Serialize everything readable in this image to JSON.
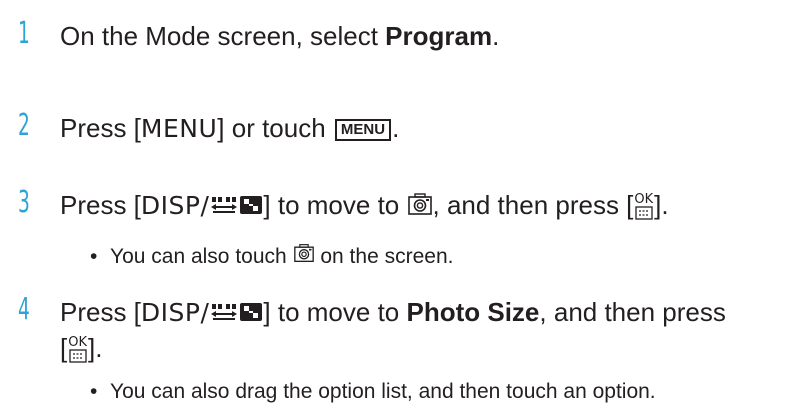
{
  "steps": [
    {
      "number": "1",
      "text_before": "On the Mode screen, select ",
      "bold": "Program",
      "text_after": "."
    },
    {
      "number": "2",
      "text_before": "Press [",
      "key": "MENU",
      "text_mid": "] or touch ",
      "button_label": "MENU",
      "text_after": "."
    },
    {
      "number": "3",
      "text_before": "Press [",
      "key": "DISP/",
      "text_mid": "] to move to ",
      "text_mid2": ", and then press [",
      "text_after": "].",
      "sub_bullet": "•",
      "sub_before": "You can also touch ",
      "sub_after": " on the screen."
    },
    {
      "number": "4",
      "text_before": "Press [",
      "key": "DISP/",
      "text_mid": "] to move to ",
      "bold": "Photo Size",
      "text_mid2": ", and then press",
      "line2_before": "[",
      "line2_after": "].",
      "sub_bullet": "•",
      "sub_text": "You can also drag the option list, and then touch an option."
    }
  ],
  "ok_icon_text": "OK",
  "icons": [
    "camera-icon",
    "ok-button-icon",
    "dpad-icon",
    "grid-icon"
  ],
  "colors": {
    "step_number": "#2fa3d6",
    "text": "#231f20"
  }
}
